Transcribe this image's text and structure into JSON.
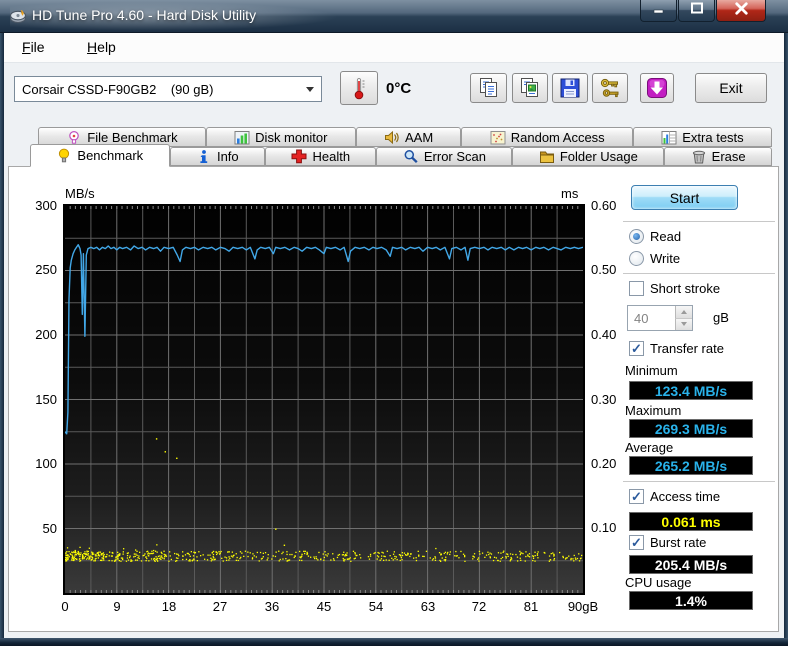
{
  "window": {
    "title": "HD Tune Pro 4.60 - Hard Disk Utility",
    "controls": [
      {
        "name": "minimize",
        "icon": "minimize-icon"
      },
      {
        "name": "maximize",
        "icon": "maximize-icon"
      },
      {
        "name": "close",
        "icon": "close-icon"
      }
    ],
    "app_icon": "disk-icon"
  },
  "menu": {
    "items": [
      "File",
      "Help"
    ]
  },
  "toolbar": {
    "drive_select": "Corsair CSSD-F90GB2    (90 gB)",
    "temperature_button_icon": "thermometer-icon",
    "temperature": "0°C",
    "buttons": [
      {
        "name": "copy-text",
        "icon": "copy-text-icon"
      },
      {
        "name": "copy-image",
        "icon": "copy-image-icon"
      },
      {
        "name": "save",
        "icon": "save-icon"
      },
      {
        "name": "options",
        "icon": "keys-icon"
      },
      {
        "name": "update",
        "icon": "download-icon"
      }
    ],
    "exit_label": "Exit"
  },
  "tabs": {
    "row1": [
      {
        "label": "File Benchmark",
        "icon": "bulb-outline-icon"
      },
      {
        "label": "Disk monitor",
        "icon": "bar-chart-icon"
      },
      {
        "label": "AAM",
        "icon": "speaker-icon"
      },
      {
        "label": "Random Access",
        "icon": "random-dots-icon"
      },
      {
        "label": "Extra tests",
        "icon": "extra-tests-icon"
      }
    ],
    "row2": [
      {
        "label": "Benchmark",
        "icon": "bulb-yellow-icon",
        "active": true
      },
      {
        "label": "Info",
        "icon": "info-icon"
      },
      {
        "label": "Health",
        "icon": "health-icon"
      },
      {
        "label": "Error Scan",
        "icon": "magnifier-icon"
      },
      {
        "label": "Folder Usage",
        "icon": "folder-icon"
      },
      {
        "label": "Erase",
        "icon": "trash-icon"
      }
    ],
    "active_tab": "Benchmark"
  },
  "panel": {
    "start_label": "Start",
    "read_label": "Read",
    "read_selected": true,
    "write_label": "Write",
    "write_selected": false,
    "short_stroke_label": "Short stroke",
    "short_stroke_checked": false,
    "capacity_value": "40",
    "capacity_unit": "gB",
    "transfer_rate_label": "Transfer rate",
    "transfer_rate_checked": true,
    "minimum_label": "Minimum",
    "minimum_value": "123.4 MB/s",
    "maximum_label": "Maximum",
    "maximum_value": "269.3 MB/s",
    "average_label": "Average",
    "average_value": "265.2 MB/s",
    "access_time_label": "Access time",
    "access_time_checked": true,
    "access_time_value": "0.061 ms",
    "burst_rate_label": "Burst rate",
    "burst_rate_checked": true,
    "burst_rate_value": "205.4 MB/s",
    "cpu_usage_label": "CPU usage",
    "cpu_usage_value": "1.4%"
  },
  "colors": {
    "transfer_line": "#42a8e8",
    "access_scatter": "#ffff00",
    "value_blue": "#29b2ea",
    "value_yellow": "#ffff00",
    "value_white": "#ffffff"
  },
  "chart_data": {
    "type": "line",
    "left_axis": {
      "label": "MB/s",
      "min": 0,
      "max": 300,
      "ticks": [
        300,
        250,
        200,
        150,
        100,
        50
      ]
    },
    "right_axis": {
      "label": "ms",
      "min": 0,
      "max": 0.6,
      "ticks": [
        "0.60",
        "0.50",
        "0.40",
        "0.30",
        "0.20",
        "0.10"
      ]
    },
    "x_axis": {
      "min": 0,
      "max": 90,
      "tick_labels": [
        "0",
        "9",
        "18",
        "27",
        "36",
        "45",
        "54",
        "63",
        "72",
        "81",
        "90gB"
      ]
    },
    "grid": {
      "v_step_gb": 4.5,
      "h_step_mbs": 25
    },
    "series": [
      {
        "name": "transfer_rate",
        "axis": "left",
        "type": "line",
        "points": [
          [
            0,
            125
          ],
          [
            0.3,
            123.4
          ],
          [
            0.5,
            140
          ],
          [
            0.7,
            228
          ],
          [
            0.9,
            252
          ],
          [
            1.1,
            258
          ],
          [
            1.4,
            263
          ],
          [
            1.7,
            266
          ],
          [
            2.0,
            268
          ],
          [
            2.3,
            270
          ],
          [
            2.6,
            267
          ],
          [
            2.8,
            262
          ],
          [
            3.0,
            216
          ],
          [
            3.2,
            263
          ],
          [
            3.45,
            199
          ],
          [
            3.7,
            262
          ],
          [
            4.0,
            267
          ],
          [
            4.5,
            268
          ],
          [
            5,
            267
          ],
          [
            5.5,
            268
          ],
          [
            6,
            266
          ],
          [
            6.5,
            268
          ],
          [
            7,
            267
          ],
          [
            7.5,
            269
          ],
          [
            8,
            267
          ],
          [
            8.5,
            268
          ],
          [
            9,
            266
          ],
          [
            9.5,
            268
          ],
          [
            10,
            267
          ],
          [
            10.7,
            268
          ],
          [
            11.4,
            266
          ],
          [
            12,
            269
          ],
          [
            12.7,
            267
          ],
          [
            13.4,
            268
          ],
          [
            14,
            266
          ],
          [
            14.7,
            268
          ],
          [
            15.4,
            267
          ],
          [
            16,
            268
          ],
          [
            16.6,
            265
          ],
          [
            17.2,
            268
          ],
          [
            18,
            267
          ],
          [
            18.8,
            268
          ],
          [
            19.5,
            262
          ],
          [
            20,
            257
          ],
          [
            20.4,
            266
          ],
          [
            21,
            268
          ],
          [
            21.8,
            267
          ],
          [
            22.5,
            268
          ],
          [
            23.2,
            266
          ],
          [
            24,
            268
          ],
          [
            24.8,
            267
          ],
          [
            25.5,
            268
          ],
          [
            26.2,
            266
          ],
          [
            27,
            268
          ],
          [
            27.8,
            267
          ],
          [
            28.5,
            265
          ],
          [
            29.2,
            268
          ],
          [
            30,
            267
          ],
          [
            30.8,
            268
          ],
          [
            31.5,
            266
          ],
          [
            32.2,
            268
          ],
          [
            33,
            259
          ],
          [
            33.4,
            266
          ],
          [
            34,
            268
          ],
          [
            34.8,
            267
          ],
          [
            35.5,
            268
          ],
          [
            36.2,
            263
          ],
          [
            36.6,
            268
          ],
          [
            37.4,
            267
          ],
          [
            38.2,
            268
          ],
          [
            39,
            266
          ],
          [
            39.8,
            268
          ],
          [
            40.5,
            267
          ],
          [
            41.2,
            265
          ],
          [
            42,
            268
          ],
          [
            42.8,
            267
          ],
          [
            43.5,
            268
          ],
          [
            44.2,
            266
          ],
          [
            45,
            263
          ],
          [
            45.4,
            268
          ],
          [
            46.2,
            267
          ],
          [
            47,
            268
          ],
          [
            47.8,
            266
          ],
          [
            48.5,
            268
          ],
          [
            49.2,
            257
          ],
          [
            49.6,
            265
          ],
          [
            50.4,
            268
          ],
          [
            51.2,
            267
          ],
          [
            52,
            268
          ],
          [
            52.8,
            266
          ],
          [
            53.5,
            268
          ],
          [
            54.2,
            267
          ],
          [
            55,
            268
          ],
          [
            55.8,
            266
          ],
          [
            56.5,
            261
          ],
          [
            56.9,
            268
          ],
          [
            57.7,
            267
          ],
          [
            58.5,
            268
          ],
          [
            59.2,
            266
          ],
          [
            60,
            268
          ],
          [
            60.8,
            267
          ],
          [
            61.5,
            268
          ],
          [
            62.2,
            265
          ],
          [
            63,
            268
          ],
          [
            63.8,
            267
          ],
          [
            64.5,
            268
          ],
          [
            65.2,
            266
          ],
          [
            66,
            268
          ],
          [
            66.8,
            259
          ],
          [
            67.2,
            267
          ],
          [
            68,
            268
          ],
          [
            68.8,
            266
          ],
          [
            69.5,
            268
          ],
          [
            70,
            258
          ],
          [
            70.4,
            267
          ],
          [
            71.2,
            268
          ],
          [
            72,
            267
          ],
          [
            72.8,
            268
          ],
          [
            73.5,
            266
          ],
          [
            74.2,
            268
          ],
          [
            75,
            267
          ],
          [
            75.8,
            268
          ],
          [
            76.5,
            266
          ],
          [
            77.2,
            268
          ],
          [
            78,
            266
          ],
          [
            78.8,
            268
          ],
          [
            79.5,
            267
          ],
          [
            80.2,
            268
          ],
          [
            81,
            266
          ],
          [
            81.8,
            268
          ],
          [
            82.5,
            267
          ],
          [
            83.2,
            268
          ],
          [
            84,
            266
          ],
          [
            84.8,
            268
          ],
          [
            85.5,
            267
          ],
          [
            86.2,
            266
          ],
          [
            87,
            268
          ],
          [
            87.8,
            267
          ],
          [
            88.5,
            268
          ],
          [
            89.2,
            267
          ],
          [
            90,
            268
          ]
        ]
      },
      {
        "name": "access_time",
        "axis": "right",
        "type": "scatter",
        "y_band_ms": [
          0.05,
          0.066
        ],
        "count": 650,
        "x_skew": 1.55,
        "seed": 987654321,
        "outliers": [
          [
            15.8,
            0.24
          ],
          [
            17.3,
            0.22
          ],
          [
            19.3,
            0.21
          ],
          [
            36.5,
            0.1
          ],
          [
            38,
            0.075
          ]
        ]
      }
    ]
  }
}
